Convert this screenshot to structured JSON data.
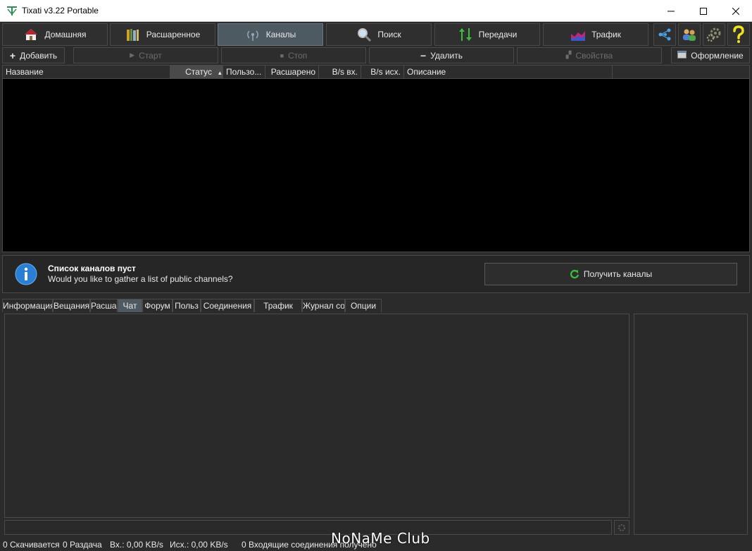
{
  "window": {
    "title": "Tixati v3.22 Portable"
  },
  "nav": {
    "home": "Домашняя",
    "extended": "Расшаренное",
    "channels": "Каналы",
    "search": "Поиск",
    "transfers": "Передачи",
    "traffic": "Трафик"
  },
  "toolbar": {
    "add": "Добавить",
    "start": "Старт",
    "stop": "Стоп",
    "delete": "Удалить",
    "properties": "Свойства",
    "appearance": "Оформление"
  },
  "table": {
    "columns": [
      "Название",
      "Статус",
      "Пользо...",
      "Расшарено",
      "B/s вх.",
      "B/s исх.",
      "Описание"
    ],
    "rows": []
  },
  "info": {
    "title": "Список каналов пуст",
    "subtitle": "Would you like to gather a list of public channels?",
    "button": "Получить каналы"
  },
  "tabs": [
    "Информация",
    "Вещания",
    "Расшар",
    "Чат",
    "Форум",
    "Польз",
    "Соединения",
    "Трафик",
    "Журнал со",
    "Опции"
  ],
  "chat": {
    "input_value": ""
  },
  "status": {
    "downloading": "0 Скачивается",
    "seeding": "0 Раздача",
    "in": "Вх.: 0,00 KB/s",
    "out": "Исх.: 0,00 KB/s",
    "incoming": "0 Входящие соединения получено"
  },
  "watermark": "NoNaMe Club",
  "colors": {
    "accent": "#4e5a61",
    "background": "#2b2b2b",
    "table_bg": "#000000"
  }
}
